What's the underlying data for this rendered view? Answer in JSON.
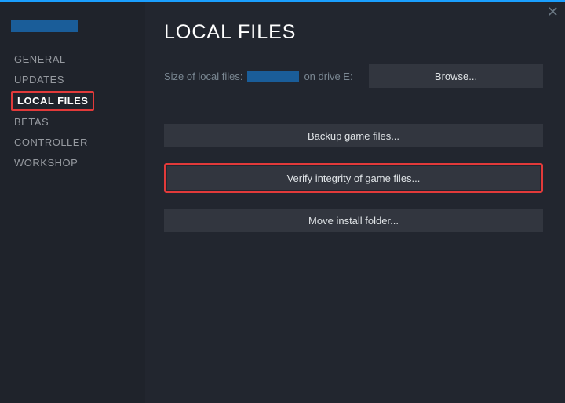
{
  "header": {
    "title": "LOCAL FILES"
  },
  "sidebar": {
    "items": [
      {
        "label": "GENERAL"
      },
      {
        "label": "UPDATES"
      },
      {
        "label": "LOCAL FILES"
      },
      {
        "label": "BETAS"
      },
      {
        "label": "CONTROLLER"
      },
      {
        "label": "WORKSHOP"
      }
    ]
  },
  "size_row": {
    "label": "Size of local files:",
    "drive": "on drive E:",
    "browse": "Browse..."
  },
  "actions": {
    "backup": "Backup game files...",
    "verify": "Verify integrity of game files...",
    "move": "Move install folder..."
  }
}
